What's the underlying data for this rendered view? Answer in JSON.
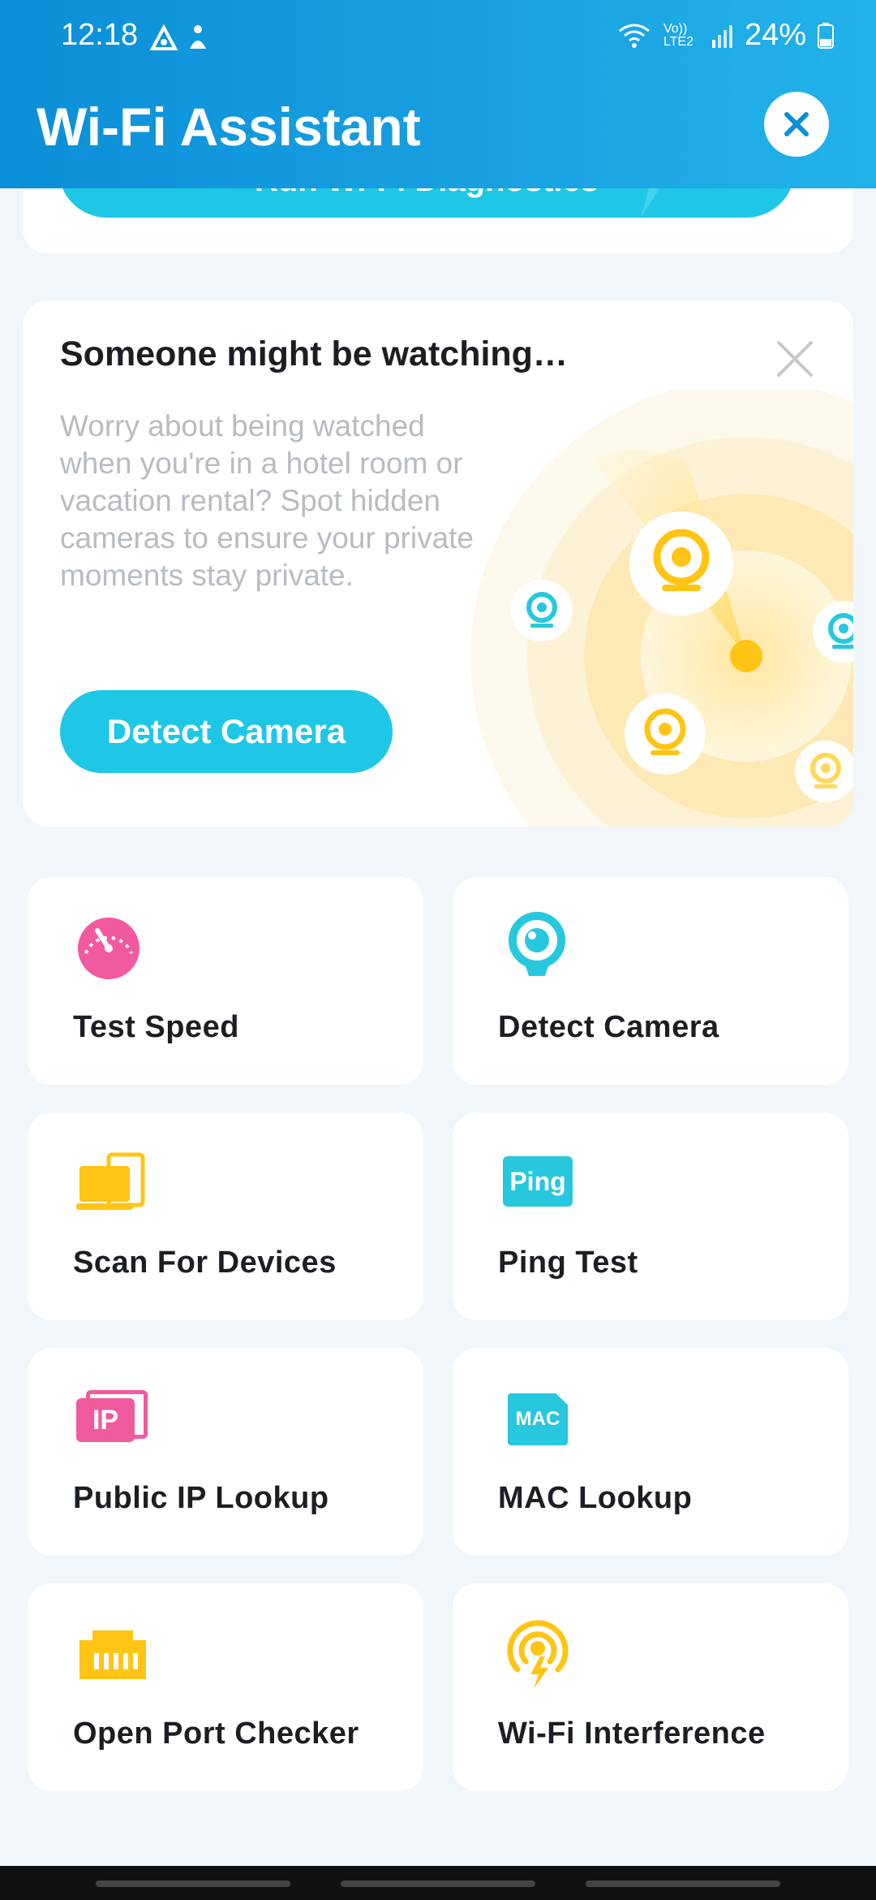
{
  "status": {
    "time": "12:18",
    "network": "Vo)) LTE2",
    "battery": "24%"
  },
  "header": {
    "title": "Wi-Fi Assistant"
  },
  "diagnostics": {
    "label": "Run Wi-Fi Diagnostics"
  },
  "promo": {
    "title": "Someone might be watching…",
    "description": "Worry about being watched when you're in a hotel room or vacation rental? Spot hidden cameras to ensure your private moments stay private.",
    "button": "Detect Camera"
  },
  "tools": [
    {
      "label": "Test Speed",
      "icon": "speedometer-icon",
      "color": "#f25aa0"
    },
    {
      "label": "Detect Camera",
      "icon": "camera-icon",
      "color": "#27c8de"
    },
    {
      "label": "Scan For Devices",
      "icon": "devices-icon",
      "color": "#ffc414"
    },
    {
      "label": "Ping Test",
      "icon": "ping-icon",
      "color": "#27c8de",
      "icon_text": "Ping"
    },
    {
      "label": "Public IP Lookup",
      "icon": "ip-icon",
      "color": "#f25aa0",
      "icon_text": "IP"
    },
    {
      "label": "MAC Lookup",
      "icon": "mac-icon",
      "color": "#27c8de",
      "icon_text": "MAC"
    },
    {
      "label": "Open Port Checker",
      "icon": "port-icon",
      "color": "#ffc414"
    },
    {
      "label": "Wi-Fi Interference",
      "icon": "interference-icon",
      "color": "#ffc414"
    }
  ],
  "colors": {
    "header": "#1aa2e2",
    "accent": "#1ec7e6",
    "background": "#f0f6f9"
  }
}
